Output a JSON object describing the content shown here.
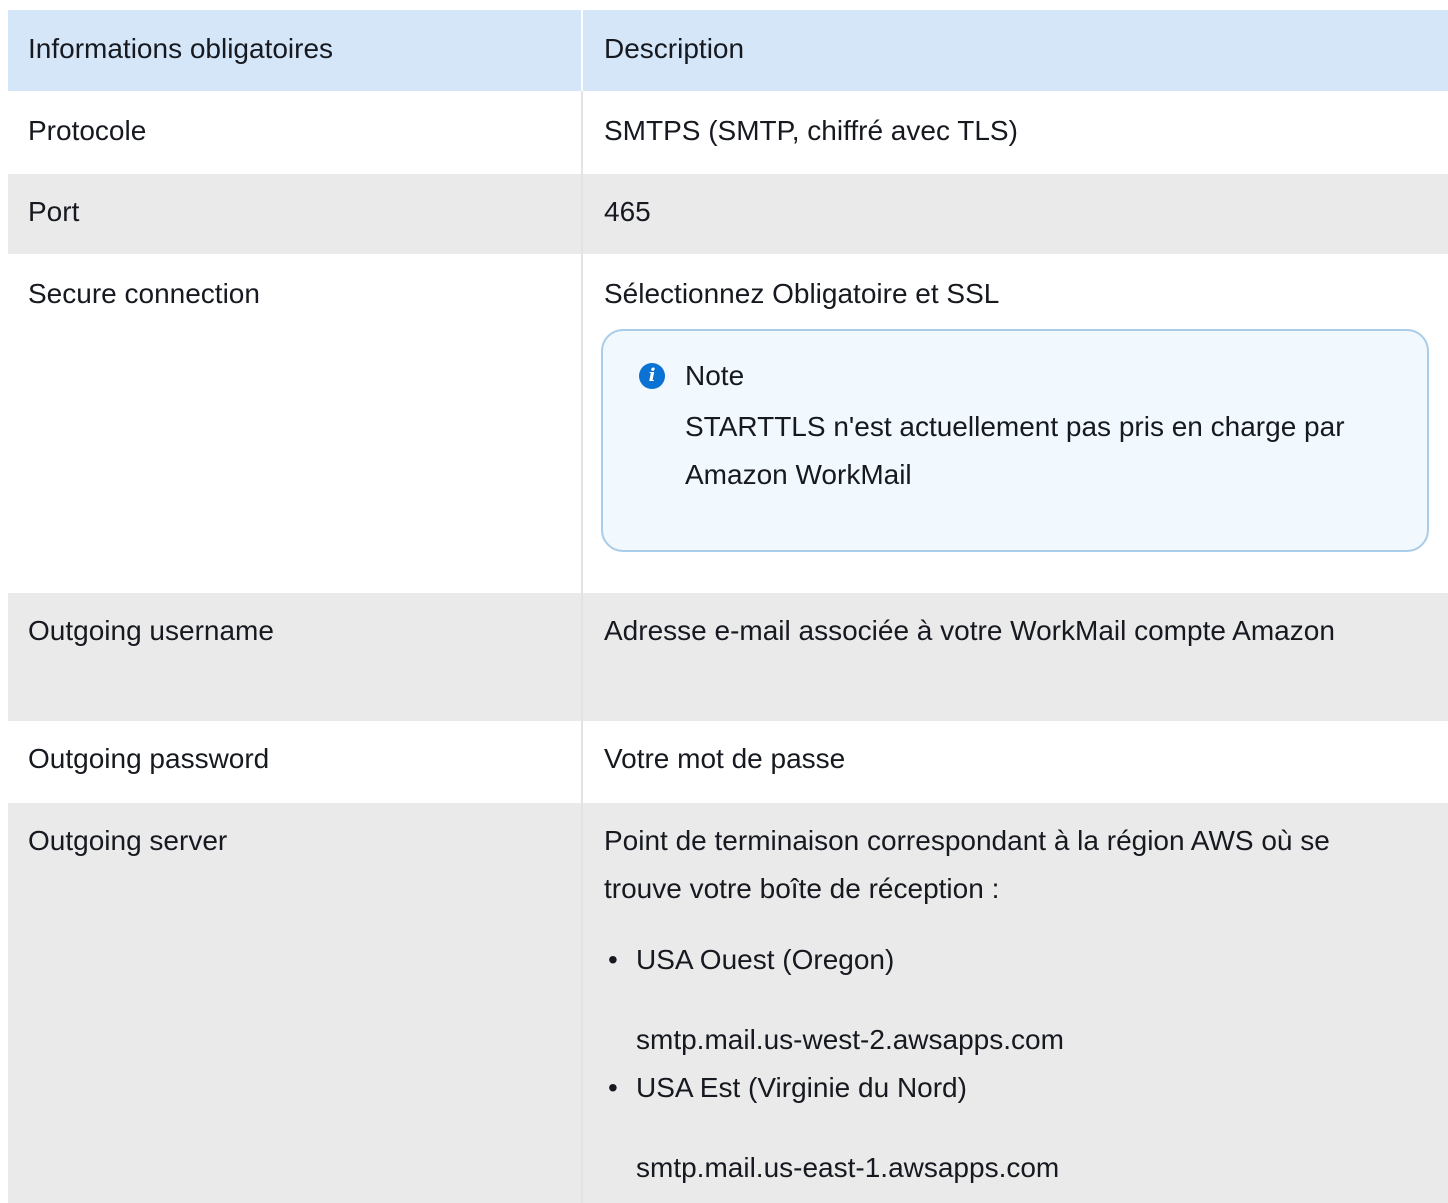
{
  "table": {
    "headers": {
      "left": "Informations obligatoires",
      "right": "Description"
    },
    "rows": [
      {
        "label": "Protocole",
        "value": "SMTPS (SMTP, chiffré avec TLS)"
      },
      {
        "label": "Port",
        "value": "465"
      },
      {
        "label": "Secure connection",
        "value": "Sélectionnez Obligatoire et SSL"
      },
      {
        "label": "Outgoing username",
        "value": "Adresse e-mail associée à votre WorkMail compte Amazon"
      },
      {
        "label": "Outgoing password",
        "value": "Votre mot de passe"
      },
      {
        "label": "Outgoing server",
        "value": "Point de terminaison correspondant à la région AWS où se trouve votre boîte de réception :"
      }
    ]
  },
  "note": {
    "icon": "info-icon",
    "title": "Note",
    "text": "STARTTLS n'est actuellement pas pris en charge par Amazon WorkMail"
  },
  "regions": [
    {
      "name": "USA Ouest (Oregon)",
      "endpoint": "smtp.mail.us-west-2.awsapps.com"
    },
    {
      "name": "USA Est (Virginie du Nord)",
      "endpoint": "smtp.mail.us-east-1.awsapps.com"
    }
  ],
  "colors": {
    "header_bg": "#d5e6f8",
    "stripe_bg": "#eaeaeb",
    "note_border": "#a9cce8",
    "note_bg": "#f1f8fe",
    "info_icon": "#0972d3"
  }
}
